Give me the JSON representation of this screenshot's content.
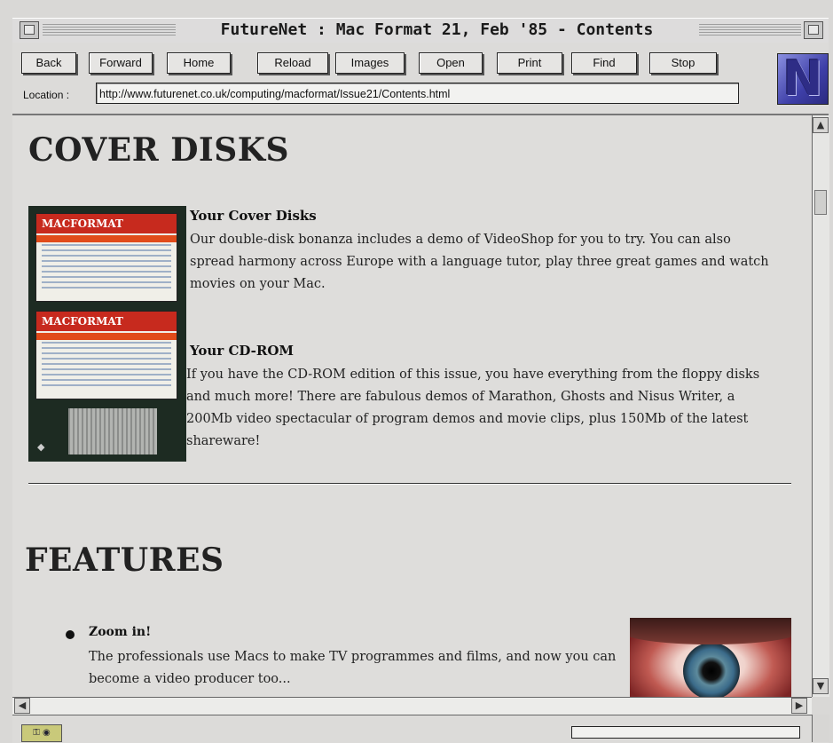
{
  "window": {
    "title": "FutureNet : Mac Format 21, Feb '85 - Contents"
  },
  "toolbar": {
    "buttons": [
      "Back",
      "Forward",
      "Home",
      "Reload",
      "Images",
      "Open",
      "Print",
      "Find",
      "Stop"
    ],
    "location_label": "Location :",
    "location_value": "http://www.futurenet.co.uk/computing/macformat/Issue21/Contents.html",
    "logo_letter": "N"
  },
  "content": {
    "cover_disks": {
      "heading": "COVER DISKS",
      "items": [
        {
          "title": "Your Cover Disks",
          "body": "Our double-disk bonanza includes a demo of VideoShop for you to try. You can also spread harmony across Europe with a language tutor, play three great games and watch movies on your Mac."
        },
        {
          "title": "Your CD-ROM",
          "body": "If you have the CD-ROM edition of this issue, you have everything from the floppy disks and much more! There are fabulous demos of Marathon, Ghosts and Nisus Writer, a 200Mb video spectacular of program demos and movie clips, plus 150Mb of the latest shareware!"
        }
      ],
      "image_label": "MACFORMAT"
    },
    "features": {
      "heading": "FEATURES",
      "items": [
        {
          "title": "Zoom in!",
          "body": "The professionals use Macs to make TV programmes and films, and now you can become a video producer too..."
        }
      ]
    }
  },
  "colors": {
    "page_bg": "#dedddb",
    "logo_blue": "#3e3fa8",
    "disk_red": "#c72a1e"
  }
}
